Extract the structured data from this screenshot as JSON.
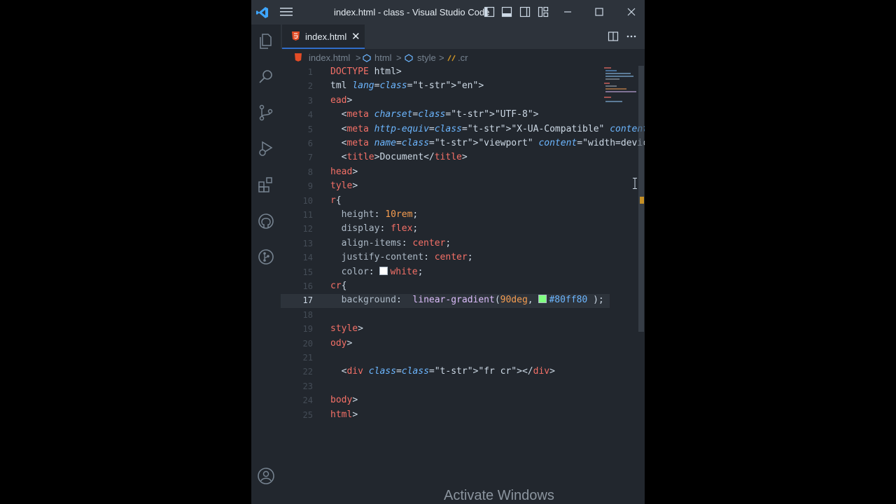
{
  "window": {
    "title": "index.html - class - Visual Studio Code",
    "accent": "#316dca"
  },
  "tab": {
    "label": "index.html",
    "close": "✕"
  },
  "breadcrumb": {
    "items": [
      "index.html",
      "html",
      "style",
      ".cr"
    ],
    "separator": ">"
  },
  "code": {
    "active_line": 17,
    "lines": [
      {
        "n": "1",
        "text": "DOCTYPE html>"
      },
      {
        "n": "2",
        "text": "tml lang=\"en\">"
      },
      {
        "n": "3",
        "text": "ead>"
      },
      {
        "n": "4",
        "text": "  <meta charset=\"UTF-8\">"
      },
      {
        "n": "5",
        "text": "  <meta http-equiv=\"X-UA-Compatible\" content=\"IE=e"
      },
      {
        "n": "6",
        "text": "  <meta name=\"viewport\" content=\"width=device-widt"
      },
      {
        "n": "7",
        "text": "  <title>Document</title>"
      },
      {
        "n": "8",
        "text": "head>"
      },
      {
        "n": "9",
        "text": "tyle>"
      },
      {
        "n": "10",
        "text": "r{"
      },
      {
        "n": "11",
        "text": "  height: 10rem;"
      },
      {
        "n": "12",
        "text": "  display: flex;"
      },
      {
        "n": "13",
        "text": "  align-items: center;"
      },
      {
        "n": "14",
        "text": "  justify-content: center;"
      },
      {
        "n": "15",
        "text": "  color: white;"
      },
      {
        "n": "16",
        "text": "cr{"
      },
      {
        "n": "17",
        "text": "  background:  linear-gradient(90deg, #80ff80 );"
      },
      {
        "n": "18",
        "text": ""
      },
      {
        "n": "19",
        "text": "style>"
      },
      {
        "n": "20",
        "text": "ody>"
      },
      {
        "n": "21",
        "text": ""
      },
      {
        "n": "22",
        "text": "  <div class=\"fr cr\"></div>"
      },
      {
        "n": "23",
        "text": ""
      },
      {
        "n": "24",
        "text": "body>"
      },
      {
        "n": "25",
        "text": "html>"
      }
    ],
    "swatches": {
      "white": "#ffffff",
      "green": "#80ff80"
    }
  },
  "activity_icons": [
    "explorer-icon",
    "search-icon",
    "source-control-icon",
    "run-debug-icon",
    "extensions-icon",
    "github-icon",
    "git-graph-icon",
    "account-icon"
  ],
  "watermark": "Activate Windows"
}
